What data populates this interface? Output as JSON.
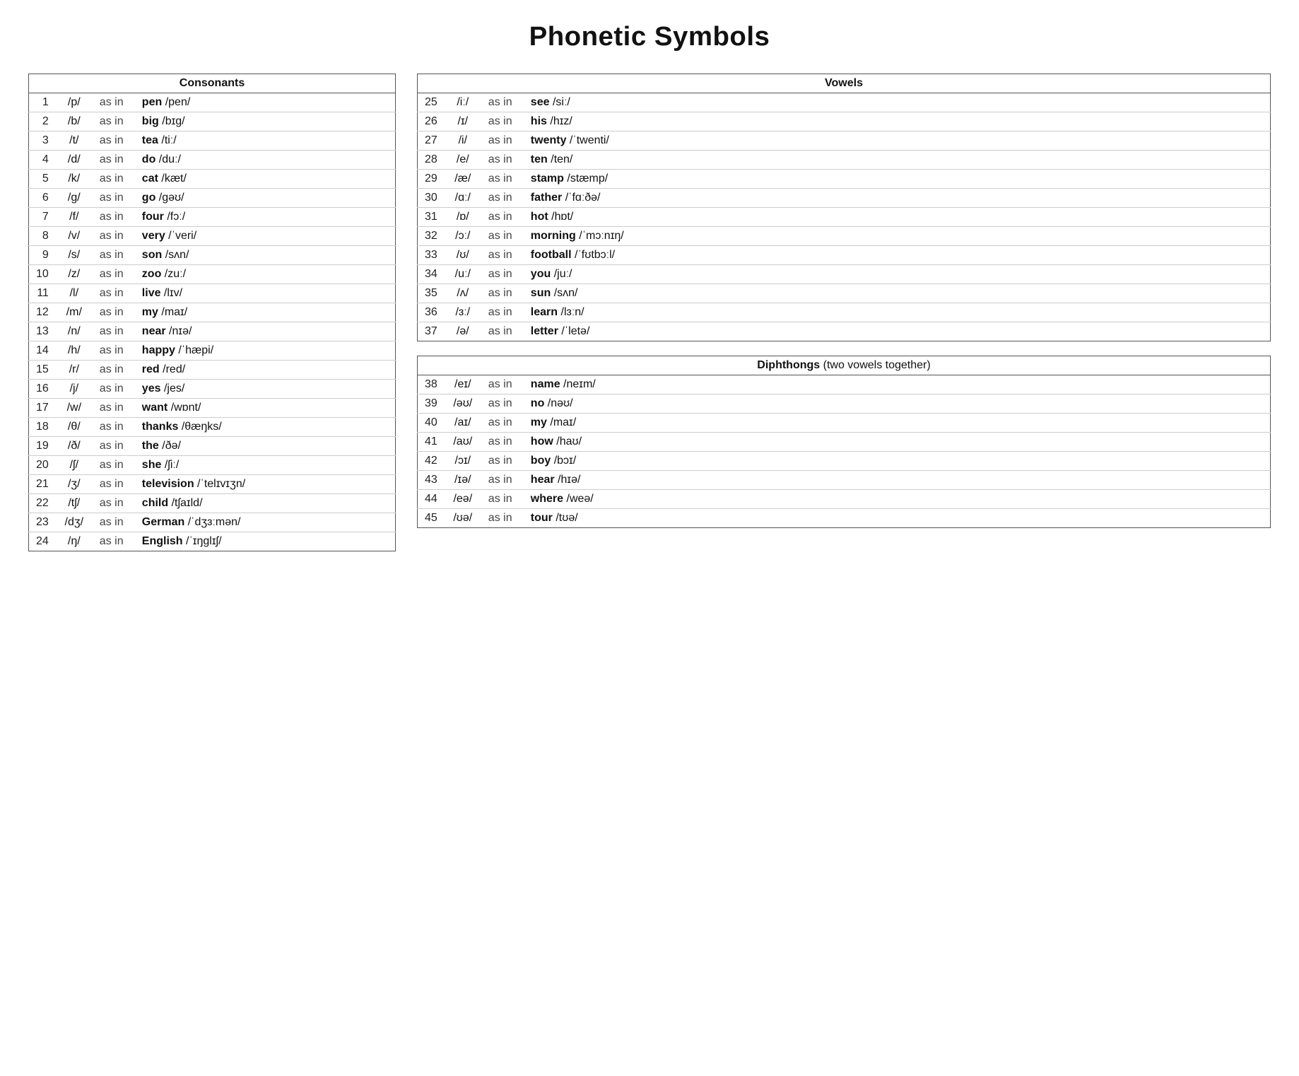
{
  "title": "Phonetic Symbols",
  "consonants": {
    "header": "Consonants",
    "rows": [
      {
        "num": "1",
        "sym": "/p/",
        "asin": "as in",
        "word": "pen",
        "pron": "/pen/"
      },
      {
        "num": "2",
        "sym": "/b/",
        "asin": "as in",
        "word": "big",
        "pron": "/bɪg/"
      },
      {
        "num": "3",
        "sym": "/t/",
        "asin": "as in",
        "word": "tea",
        "pron": "/tiː/"
      },
      {
        "num": "4",
        "sym": "/d/",
        "asin": "as in",
        "word": "do",
        "pron": "/duː/"
      },
      {
        "num": "5",
        "sym": "/k/",
        "asin": "as in",
        "word": "cat",
        "pron": "/kæt/"
      },
      {
        "num": "6",
        "sym": "/g/",
        "asin": "as in",
        "word": "go",
        "pron": "/gəʊ/"
      },
      {
        "num": "7",
        "sym": "/f/",
        "asin": "as in",
        "word": "four",
        "pron": "/fɔː/"
      },
      {
        "num": "8",
        "sym": "/v/",
        "asin": "as in",
        "word": "very",
        "pron": "/ˈveri/"
      },
      {
        "num": "9",
        "sym": "/s/",
        "asin": "as in",
        "word": "son",
        "pron": "/sʌn/"
      },
      {
        "num": "10",
        "sym": "/z/",
        "asin": "as in",
        "word": "zoo",
        "pron": "/zuː/"
      },
      {
        "num": "11",
        "sym": "/l/",
        "asin": "as in",
        "word": "live",
        "pron": "/lɪv/"
      },
      {
        "num": "12",
        "sym": "/m/",
        "asin": "as in",
        "word": "my",
        "pron": "/maɪ/"
      },
      {
        "num": "13",
        "sym": "/n/",
        "asin": "as in",
        "word": "near",
        "pron": "/nɪə/"
      },
      {
        "num": "14",
        "sym": "/h/",
        "asin": "as in",
        "word": "happy",
        "pron": "/ˈhæpi/"
      },
      {
        "num": "15",
        "sym": "/r/",
        "asin": "as in",
        "word": "red",
        "pron": "/red/"
      },
      {
        "num": "16",
        "sym": "/j/",
        "asin": "as in",
        "word": "yes",
        "pron": "/jes/"
      },
      {
        "num": "17",
        "sym": "/w/",
        "asin": "as in",
        "word": "want",
        "pron": "/wɒnt/"
      },
      {
        "num": "18",
        "sym": "/θ/",
        "asin": "as in",
        "word": "thanks",
        "pron": "/θæŋks/"
      },
      {
        "num": "19",
        "sym": "/ð/",
        "asin": "as in",
        "word": "the",
        "pron": "/ðə/"
      },
      {
        "num": "20",
        "sym": "/ʃ/",
        "asin": "as in",
        "word": "she",
        "pron": "/ʃiː/"
      },
      {
        "num": "21",
        "sym": "/ʒ/",
        "asin": "as in",
        "word": "television",
        "pron": "/ˈtelɪvɪʒn/"
      },
      {
        "num": "22",
        "sym": "/tʃ/",
        "asin": "as in",
        "word": "child",
        "pron": "/tʃaɪld/"
      },
      {
        "num": "23",
        "sym": "/dʒ/",
        "asin": "as in",
        "word": "German",
        "pron": "/ˈdʒɜːmən/"
      },
      {
        "num": "24",
        "sym": "/ŋ/",
        "asin": "as in",
        "word": "English",
        "pron": "/ˈɪŋglɪʃ/"
      }
    ]
  },
  "vowels": {
    "header": "Vowels",
    "rows": [
      {
        "num": "25",
        "sym": "/iː/",
        "asin": "as in",
        "word": "see",
        "pron": "/siː/"
      },
      {
        "num": "26",
        "sym": "/ɪ/",
        "asin": "as in",
        "word": "his",
        "pron": "/hɪz/"
      },
      {
        "num": "27",
        "sym": "/i/",
        "asin": "as in",
        "word": "twenty",
        "pron": "/ˈtwenti/"
      },
      {
        "num": "28",
        "sym": "/e/",
        "asin": "as in",
        "word": "ten",
        "pron": "/ten/"
      },
      {
        "num": "29",
        "sym": "/æ/",
        "asin": "as in",
        "word": "stamp",
        "pron": "/stæmp/"
      },
      {
        "num": "30",
        "sym": "/ɑː/",
        "asin": "as in",
        "word": "father",
        "pron": "/ˈfɑːðə/"
      },
      {
        "num": "31",
        "sym": "/ɒ/",
        "asin": "as in",
        "word": "hot",
        "pron": "/hɒt/"
      },
      {
        "num": "32",
        "sym": "/ɔː/",
        "asin": "as in",
        "word": "morning",
        "pron": "/ˈmɔːnɪŋ/"
      },
      {
        "num": "33",
        "sym": "/ʊ/",
        "asin": "as in",
        "word": "football",
        "pron": "/ˈfʊtbɔːl/"
      },
      {
        "num": "34",
        "sym": "/uː/",
        "asin": "as in",
        "word": "you",
        "pron": "/juː/"
      },
      {
        "num": "35",
        "sym": "/ʌ/",
        "asin": "as in",
        "word": "sun",
        "pron": "/sʌn/"
      },
      {
        "num": "36",
        "sym": "/ɜː/",
        "asin": "as in",
        "word": "learn",
        "pron": "/lɜːn/"
      },
      {
        "num": "37",
        "sym": "/ə/",
        "asin": "as in",
        "word": "letter",
        "pron": "/ˈletə/"
      }
    ]
  },
  "diphthongs": {
    "header_bold": "Diphthongs",
    "header_normal": " (two vowels together)",
    "rows": [
      {
        "num": "38",
        "sym": "/eɪ/",
        "asin": "as in",
        "word": "name",
        "pron": "/neɪm/"
      },
      {
        "num": "39",
        "sym": "/əʊ/",
        "asin": "as in",
        "word": "no",
        "pron": "/nəʊ/"
      },
      {
        "num": "40",
        "sym": "/aɪ/",
        "asin": "as in",
        "word": "my",
        "pron": "/maɪ/"
      },
      {
        "num": "41",
        "sym": "/aʊ/",
        "asin": "as in",
        "word": "how",
        "pron": "/haʊ/"
      },
      {
        "num": "42",
        "sym": "/ɔɪ/",
        "asin": "as in",
        "word": "boy",
        "pron": "/bɔɪ/"
      },
      {
        "num": "43",
        "sym": "/ɪə/",
        "asin": "as in",
        "word": "hear",
        "pron": "/hɪə/"
      },
      {
        "num": "44",
        "sym": "/eə/",
        "asin": "as in",
        "word": "where",
        "pron": "/weə/"
      },
      {
        "num": "45",
        "sym": "/ʊə/",
        "asin": "as in",
        "word": "tour",
        "pron": "/tʊə/"
      }
    ]
  }
}
